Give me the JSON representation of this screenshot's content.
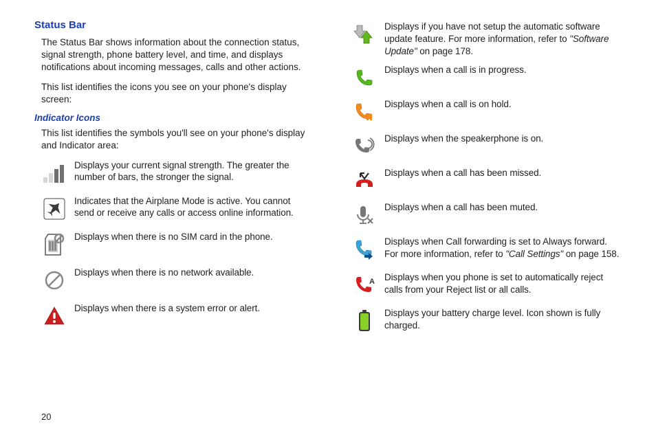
{
  "page_number": "20",
  "section_title": "Status Bar",
  "para1": "The Status Bar shows information about the connection status, signal strength, phone battery level, and time, and displays notifications about incoming messages, calls and other actions.",
  "para2": "This list identifies the icons you see on your phone's display screen:",
  "sub_title": "Indicator Icons",
  "sub_intro": "This list identifies the symbols you'll see on your phone's display and Indicator area:",
  "left_rows": [
    {
      "desc": "Displays your current signal strength. The greater the number of bars, the stronger the signal."
    },
    {
      "desc": "Indicates that the Airplane Mode is active. You cannot send or receive any calls or access online information."
    },
    {
      "desc": "Displays when there is no SIM card in the phone."
    },
    {
      "desc": "Displays when there is no network available."
    },
    {
      "desc": "Displays when there is a system error or alert."
    }
  ],
  "right_rows": [
    {
      "pre": "Displays if you have not setup the automatic software update feature. For more information, refer to ",
      "ref": "\"Software Update\"",
      "post": "  on page 178."
    },
    {
      "desc": "Displays when a call is in progress."
    },
    {
      "desc": "Displays when a call is on hold."
    },
    {
      "desc": "Displays when the speakerphone is on."
    },
    {
      "desc": "Displays when a call has been missed."
    },
    {
      "desc": "Displays when a call has been muted."
    },
    {
      "pre": "Displays when Call forwarding is set to Always forward. For more information, refer to ",
      "ref": "\"Call Settings\"",
      "post": "  on page 158."
    },
    {
      "desc": "Displays when you phone is set to automatically reject calls from your Reject list or all calls."
    },
    {
      "desc": "Displays your battery charge level. Icon shown is fully charged."
    }
  ]
}
